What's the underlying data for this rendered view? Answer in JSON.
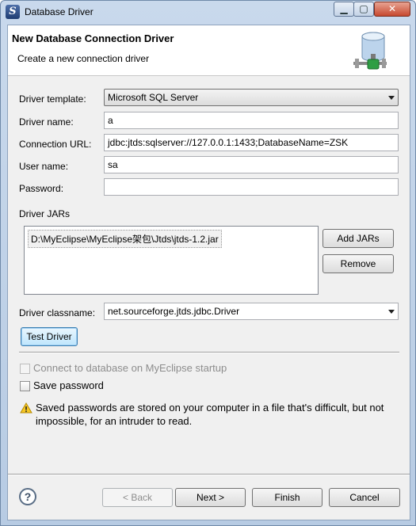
{
  "window": {
    "title": "Database Driver",
    "app_icon": "myeclipse-icon"
  },
  "header": {
    "title": "New Database Connection Driver",
    "subtitle": "Create a new connection driver",
    "icon": "database-connection-icon"
  },
  "form": {
    "driver_template_label": "Driver template:",
    "driver_template_value": "Microsoft SQL Server",
    "driver_name_label": "Driver name:",
    "driver_name_value": "a",
    "connection_url_label": "Connection URL:",
    "connection_url_value": "jdbc:jtds:sqlserver://127.0.0.1:1433;DatabaseName=ZSK",
    "user_name_label": "User name:",
    "user_name_value": "sa",
    "password_label": "Password:",
    "password_value": ""
  },
  "jars": {
    "label": "Driver JARs",
    "items": [
      "D:\\MyEclipse\\MyEclipse架包\\Jtds\\jtds-1.2.jar"
    ],
    "add_label": "Add JARs",
    "remove_label": "Remove"
  },
  "classname": {
    "label": "Driver classname:",
    "value": "net.sourceforge.jtds.jdbc.Driver"
  },
  "test_driver_label": "Test Driver",
  "options": {
    "connect_on_startup": {
      "label": "Connect to database on MyEclipse startup",
      "checked": false,
      "enabled": false
    },
    "save_password": {
      "label": "Save password",
      "checked": false,
      "enabled": true
    }
  },
  "warning": {
    "text": "Saved passwords are stored on your computer in a file that's difficult, but not impossible, for an intruder to read.",
    "icon": "warning-icon"
  },
  "footer": {
    "back_label": "< Back",
    "next_label": "Next >",
    "finish_label": "Finish",
    "cancel_label": "Cancel"
  },
  "colors": {
    "accent": "#3c7fb1",
    "frame": "#b7cbe3",
    "close": "#c7492f"
  }
}
